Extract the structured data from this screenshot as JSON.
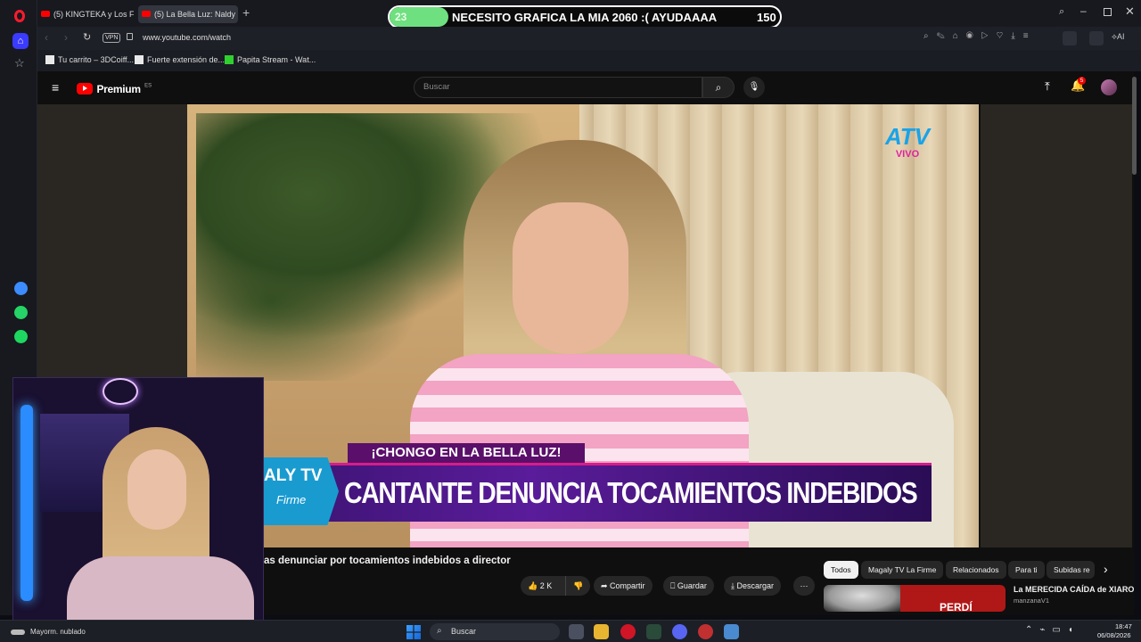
{
  "tabs": [
    {
      "label": "(5) KINGTEKA y Los Fekas"
    },
    {
      "label": "(5) La Bella Luz: Naldy"
    }
  ],
  "overlay": {
    "count": "23",
    "text": "NECESITO GRAFICA LA MIA 2060 :( AYUDAAAA",
    "goal": "150"
  },
  "address": {
    "badge": "VPN",
    "url": "www.youtube.com/watch",
    "ai_label": "AI"
  },
  "bookmarks": [
    {
      "label": "Tu carrito – 3DCoiff..."
    },
    {
      "label": "Fuerte extensión de..."
    },
    {
      "label": "Papita Stream - Wat..."
    }
  ],
  "youtube": {
    "logo": "Premium",
    "region": "ES",
    "search_placeholder": "Buscar",
    "notifications": "5",
    "video": {
      "channel_logo": "ATV",
      "live": "VIVO",
      "banner_small": "¡CHONGO EN LA BELLA LUZ!",
      "banner_big": "CANTANTE DENUNCIA TOCAMIENTOS INDEBIDOS",
      "show_logo": "ALY TV",
      "show_sub": "Firme"
    },
    "title": "as denunciar por tocamientos indebidos a director",
    "actions": {
      "likes": "2 K",
      "share": "Compartir",
      "save": "Guardar",
      "download": "Descargar"
    },
    "chips": [
      "Todos",
      "Magaly TV La Firme",
      "Relacionados",
      "Para ti",
      "Subidas re"
    ],
    "rec": {
      "title": "La MERECIDA CAÍDA de XIARO",
      "channel": "manzanaV1",
      "thumb_text": "PERDÍ"
    }
  },
  "taskbar": {
    "weather": "Mayorm. nublado",
    "search": "Buscar",
    "time": "18:47",
    "date": "06/08/2026"
  }
}
